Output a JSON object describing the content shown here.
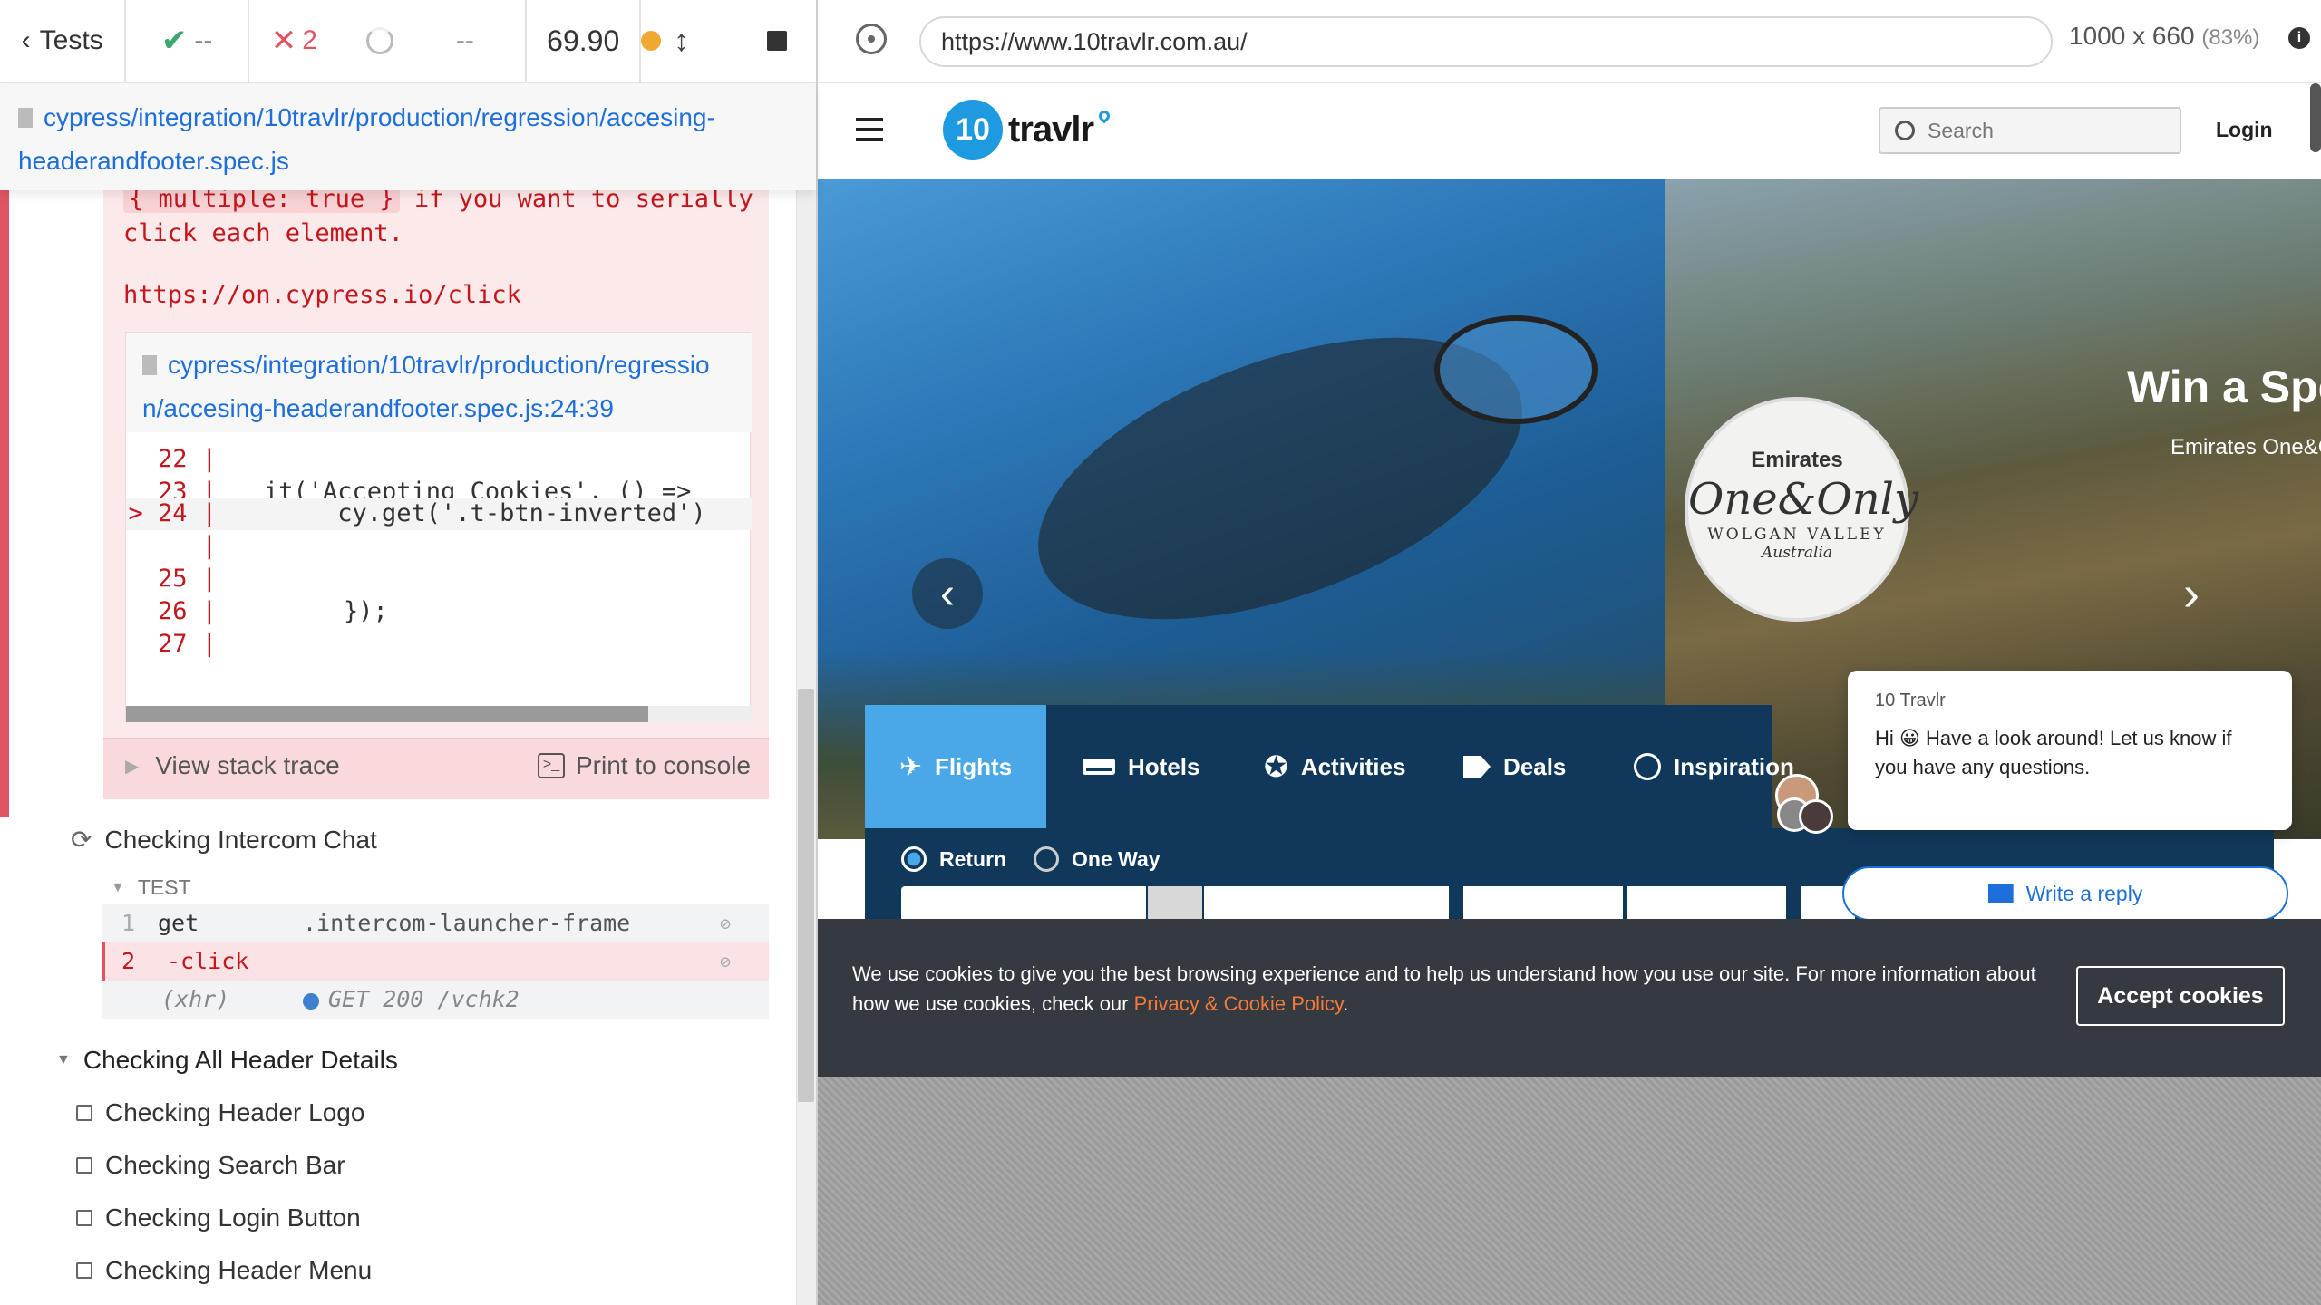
{
  "topbar": {
    "tests_label": "Tests",
    "passed": "--",
    "failed": "2",
    "pending": "--",
    "duration": "69.90",
    "indicator_color": "#f0a830"
  },
  "spec": {
    "path_line1": "cypress/integration/10travlr/production/regression/accesing-",
    "path_line2": "headerandfooter.spec.js"
  },
  "error": {
    "multiple_code": "{ multiple: true }",
    "line1_rest": " if you want to serially",
    "line2": "click each element.",
    "link": "https://on.cypress.io/click",
    "file_line1": "cypress/integration/10travlr/production/regressio",
    "file_line2": "n/accesing-headerandfooter.spec.js:24:39",
    "code_lines": [
      {
        "ln": "22 |",
        "code": ""
      },
      {
        "ln": "23 |",
        "code": "it('Accepting Cookies', () =>"
      },
      {
        "ln": "> 24 |",
        "code": "     cy.get('.t-btn-inverted')"
      },
      {
        "ln": "|",
        "code": ""
      },
      {
        "ln": "25 |",
        "code": ""
      },
      {
        "ln": "26 |",
        "code": "});"
      },
      {
        "ln": "27 |",
        "code": ""
      }
    ],
    "view_stack_trace": "View stack trace",
    "print_to_console": "Print to console"
  },
  "tests": {
    "intercom": "Checking Intercom Chat",
    "test_label": "TEST",
    "commands": [
      {
        "num": "1",
        "name": "get",
        "message": ".intercom-launcher-frame"
      },
      {
        "num": "2",
        "name": "-click",
        "message": ""
      }
    ],
    "xhr": {
      "name": "(xhr)",
      "message": "GET 200 /vchk2"
    },
    "header_suite": "Checking All Header Details",
    "header_tests": [
      "Checking Header Logo",
      "Checking Search Bar",
      "Checking Login Button",
      "Checking Header Menu"
    ]
  },
  "browser": {
    "url": "https://www.10travlr.com.au/",
    "viewport": "1000 x 660",
    "scale": "(83%)"
  },
  "site": {
    "logo_badge": "10",
    "logo_text": "travlr",
    "search_placeholder": "Search",
    "login": "Login",
    "promo_title": "Win a Spe",
    "promo_subtitle": "Emirates One&O",
    "badge_brand": "Emirates",
    "badge_title": "One&Only",
    "badge_location": "WOLGAN VALLEY",
    "badge_country": "Australia",
    "tabs": [
      "Flights",
      "Hotels",
      "Activities",
      "Deals",
      "Inspiration"
    ],
    "trip_return": "Return",
    "trip_oneway": "One Way",
    "accent": "#4aa8e8",
    "navy": "#10385a",
    "orange": "#f47a3a"
  },
  "chat": {
    "sender": "10 Travlr",
    "message_pre": "Hi ",
    "emoji": "😀",
    "message_post": " Have a look around! Let us know if you have any questions.",
    "reply": "Write a reply"
  },
  "cookie": {
    "text_pre": "We use cookies to give you the best browsing experience and to help us understand how you use our site. For more information about how we use cookies, check our ",
    "policy_link": "Privacy & Cookie Policy",
    "text_post": ".",
    "accept": "Accept cookies"
  }
}
